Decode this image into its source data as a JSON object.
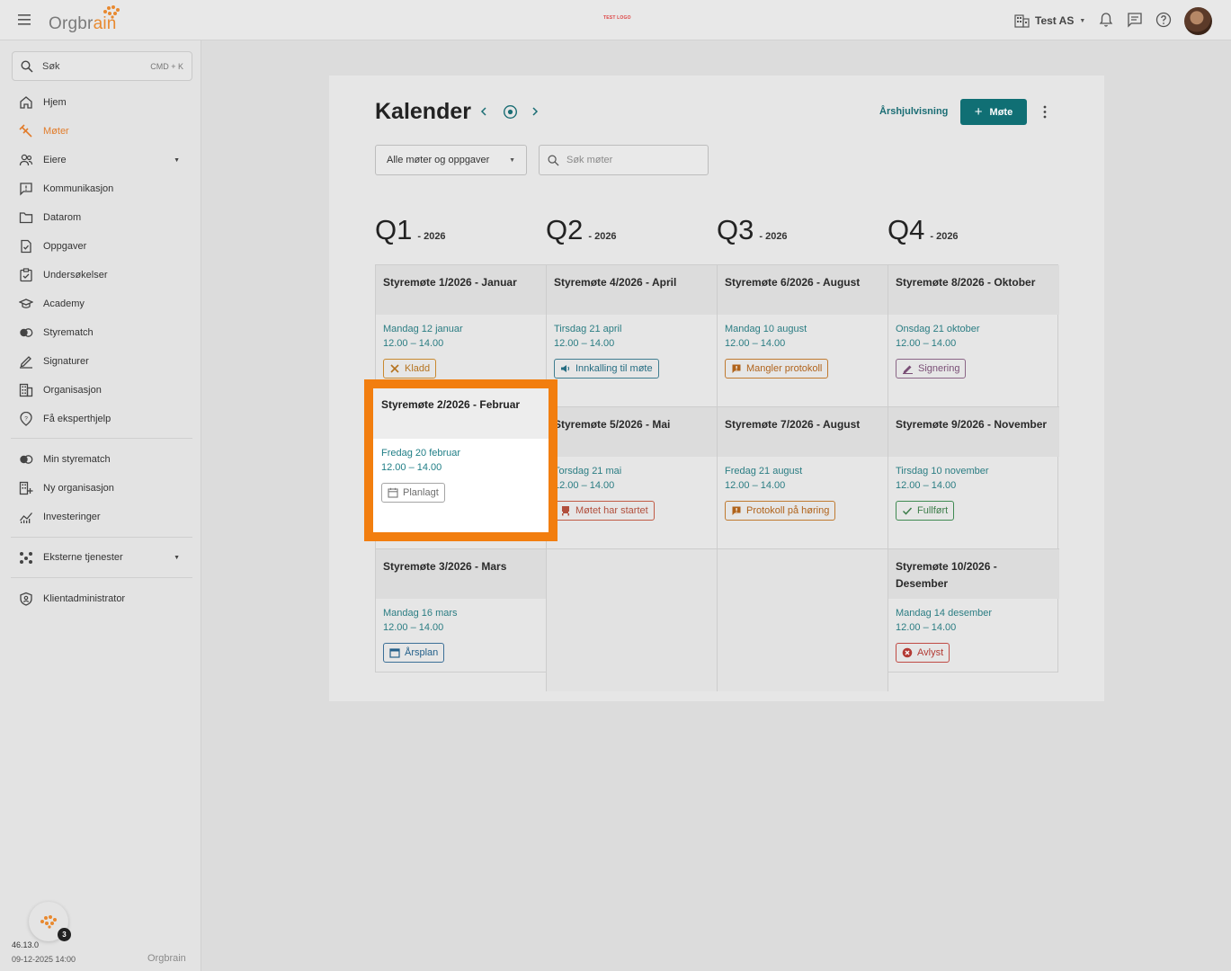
{
  "header": {
    "logo_text_a": "Orgbr",
    "logo_text_b": "ain",
    "center_logo": "TEST LOGO",
    "org_name": "Test AS"
  },
  "sidebar": {
    "search_label": "Søk",
    "search_shortcut": "CMD + K",
    "items": [
      {
        "label": "Hjem",
        "icon": "home-icon"
      },
      {
        "label": "Møter",
        "icon": "gavel-icon",
        "active": true
      },
      {
        "label": "Eiere",
        "icon": "owners-icon",
        "expandable": true
      },
      {
        "label": "Kommunikasjon",
        "icon": "chat-icon"
      },
      {
        "label": "Datarom",
        "icon": "folder-icon"
      },
      {
        "label": "Oppgaver",
        "icon": "task-icon"
      },
      {
        "label": "Undersøkelser",
        "icon": "survey-icon"
      },
      {
        "label": "Academy",
        "icon": "graduation-cap-icon"
      },
      {
        "label": "Styrematch",
        "icon": "match-icon"
      },
      {
        "label": "Signaturer",
        "icon": "signature-icon"
      },
      {
        "label": "Organisasjon",
        "icon": "building-icon"
      },
      {
        "label": "Få eksperthjelp",
        "icon": "expert-help-icon"
      },
      {
        "label": "Min styrematch",
        "icon": "match-icon"
      },
      {
        "label": "Ny organisasjon",
        "icon": "add-building-icon"
      },
      {
        "label": "Investeringer",
        "icon": "chart-icon"
      },
      {
        "label": "Eksterne tjenester",
        "icon": "services-icon",
        "expandable": true
      },
      {
        "label": "Klientadministrator",
        "icon": "shield-icon"
      }
    ],
    "notification_count": "3",
    "version": "46.13.0",
    "build_date": "09-12-2025 14:00",
    "footer_logo": "Orgbrain"
  },
  "calendar": {
    "title": "Kalender",
    "year_view_label": "Årshjulvisning",
    "add_meeting_label": "Møte",
    "filter_value": "Alle møter og oppgaver",
    "search_placeholder": "Søk møter",
    "quarters": [
      {
        "q": "Q1",
        "year": "- 2026"
      },
      {
        "q": "Q2",
        "year": "- 2026"
      },
      {
        "q": "Q3",
        "year": "- 2026"
      },
      {
        "q": "Q4",
        "year": "- 2026"
      }
    ],
    "meetings": [
      {
        "title": "Styremøte 1/2026 - Januar",
        "date": "Mandag 12 januar",
        "time": "12.00 – 14.00",
        "status": "Kladd",
        "style": "b-kladd",
        "icon": "tools-icon"
      },
      {
        "title": "Styremøte 4/2026 - April",
        "date": "Tirsdag 21 april",
        "time": "12.00 – 14.00",
        "status": "Innkalling til møte",
        "style": "b-innk",
        "icon": "megaphone-icon"
      },
      {
        "title": "Styremøte 6/2026 - August",
        "date": "Mandag 10 august",
        "time": "12.00 – 14.00",
        "status": "Mangler protokoll",
        "style": "b-mangler",
        "icon": "flag-icon"
      },
      {
        "title": "Styremøte 8/2026 - Oktober",
        "date": "Onsdag 21 oktober",
        "time": "12.00 – 14.00",
        "status": "Signering",
        "style": "b-sign",
        "icon": "pen-icon"
      },
      {
        "title": "Styremøte 2/2026 - Februar",
        "date": "Fredag 20 februar",
        "time": "12.00 – 14.00",
        "status": "Planlagt",
        "style": "b-plan",
        "icon": "calendar-icon"
      },
      {
        "title": "Styremøte 5/2026 - Mai",
        "date": "Torsdag 21 mai",
        "time": "12.00 – 14.00",
        "status": "Møtet har startet",
        "style": "b-startet",
        "icon": "presenter-icon"
      },
      {
        "title": "Styremøte 7/2026 - August",
        "date": "Fredag 21 august",
        "time": "12.00 – 14.00",
        "status": "Protokoll på høring",
        "style": "b-horing",
        "icon": "flag-icon"
      },
      {
        "title": "Styremøte 9/2026 - November",
        "date": "Tirsdag 10 november",
        "time": "12.00 – 14.00",
        "status": "Fullført",
        "style": "b-fullfort",
        "icon": "check-icon"
      },
      {
        "title": "Styremøte 3/2026 - Mars",
        "date": "Mandag 16 mars",
        "time": "12.00 – 14.00",
        "status": "Årsplan",
        "style": "b-arsplan",
        "icon": "calendar-icon"
      },
      {
        "title": "Styremøte 10/2026 - Desember",
        "date": "Mandag 14 desember",
        "time": "12.00 – 14.00",
        "status": "Avlyst",
        "style": "b-avlyst",
        "icon": "cancel-icon"
      }
    ]
  },
  "colors": {
    "accent": "#106f74",
    "brand_orange": "#e27d2c",
    "highlight": "#f27e0f"
  }
}
